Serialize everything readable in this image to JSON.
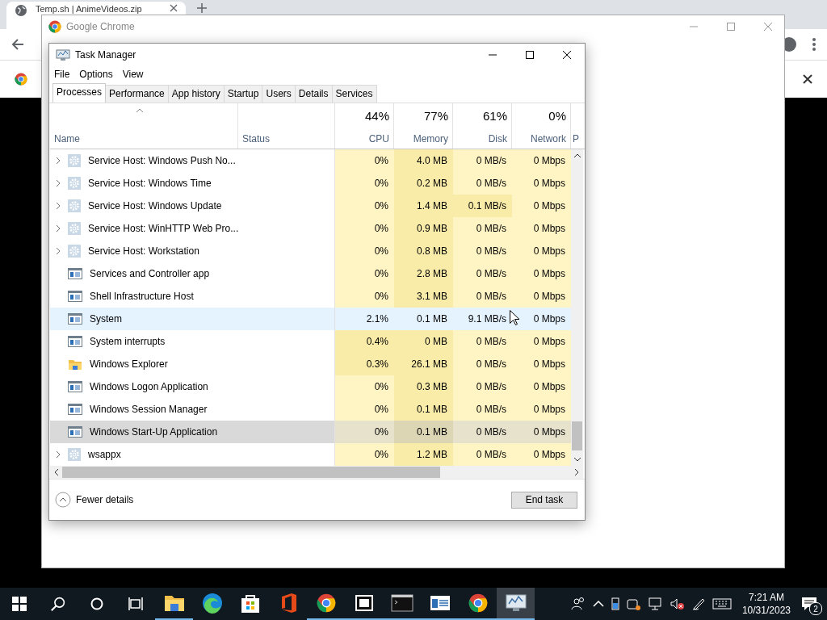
{
  "browser": {
    "tab": {
      "title": "Temp.sh | AnimeVideos.zip"
    }
  },
  "popup": {
    "title": "Google Chrome"
  },
  "window": {
    "title": "Task Manager"
  },
  "menu": [
    "File",
    "Options",
    "View"
  ],
  "tabs": [
    {
      "label": "Processes",
      "selected": true
    },
    {
      "label": "Performance",
      "selected": false
    },
    {
      "label": "App history",
      "selected": false
    },
    {
      "label": "Startup",
      "selected": false
    },
    {
      "label": "Users",
      "selected": false
    },
    {
      "label": "Details",
      "selected": false
    },
    {
      "label": "Services",
      "selected": false
    }
  ],
  "table": {
    "columns": [
      {
        "label": "Name",
        "kind": "text"
      },
      {
        "label": "Status",
        "kind": "text"
      },
      {
        "label": "CPU",
        "percent": "44%",
        "kind": "metric"
      },
      {
        "label": "Memory",
        "percent": "77%",
        "kind": "metric"
      },
      {
        "label": "Disk",
        "percent": "61%",
        "kind": "metric"
      },
      {
        "label": "Network",
        "percent": "0%",
        "kind": "metric"
      },
      {
        "label": "P",
        "kind": "cut"
      }
    ],
    "rows": [
      {
        "kind": "service",
        "expandable": true,
        "selected": false,
        "hovered": false,
        "cells": [
          {
            "text": "Service Host: Windows Push No..."
          },
          {
            "text": ""
          },
          {
            "text": "0%",
            "heavy": false
          },
          {
            "text": "4.0 MB",
            "heavy": true
          },
          {
            "text": "0 MB/s",
            "heavy": false
          },
          {
            "text": "0 Mbps",
            "heavy": false
          }
        ]
      },
      {
        "kind": "service",
        "expandable": true,
        "selected": false,
        "hovered": false,
        "cells": [
          {
            "text": "Service Host: Windows Time"
          },
          {
            "text": ""
          },
          {
            "text": "0%",
            "heavy": false
          },
          {
            "text": "0.2 MB",
            "heavy": true
          },
          {
            "text": "0 MB/s",
            "heavy": false
          },
          {
            "text": "0 Mbps",
            "heavy": false
          }
        ]
      },
      {
        "kind": "service",
        "expandable": true,
        "selected": false,
        "hovered": false,
        "cells": [
          {
            "text": "Service Host: Windows Update"
          },
          {
            "text": ""
          },
          {
            "text": "0%",
            "heavy": false
          },
          {
            "text": "1.4 MB",
            "heavy": true
          },
          {
            "text": "0.1 MB/s",
            "heavy": true
          },
          {
            "text": "0 Mbps",
            "heavy": false
          }
        ]
      },
      {
        "kind": "service",
        "expandable": true,
        "selected": false,
        "hovered": false,
        "cells": [
          {
            "text": "Service Host: WinHTTP Web Pro..."
          },
          {
            "text": ""
          },
          {
            "text": "0%",
            "heavy": false
          },
          {
            "text": "0.9 MB",
            "heavy": true
          },
          {
            "text": "0 MB/s",
            "heavy": false
          },
          {
            "text": "0 Mbps",
            "heavy": false
          }
        ]
      },
      {
        "kind": "service",
        "expandable": true,
        "selected": false,
        "hovered": false,
        "cells": [
          {
            "text": "Service Host: Workstation"
          },
          {
            "text": ""
          },
          {
            "text": "0%",
            "heavy": false
          },
          {
            "text": "0.8 MB",
            "heavy": true
          },
          {
            "text": "0 MB/s",
            "heavy": false
          },
          {
            "text": "0 Mbps",
            "heavy": false
          }
        ]
      },
      {
        "kind": "app",
        "expandable": false,
        "selected": false,
        "hovered": false,
        "cells": [
          {
            "text": "Services and Controller app"
          },
          {
            "text": ""
          },
          {
            "text": "0%",
            "heavy": false
          },
          {
            "text": "2.8 MB",
            "heavy": true
          },
          {
            "text": "0 MB/s",
            "heavy": false
          },
          {
            "text": "0 Mbps",
            "heavy": false
          }
        ]
      },
      {
        "kind": "app",
        "expandable": false,
        "selected": false,
        "hovered": false,
        "cells": [
          {
            "text": "Shell Infrastructure Host"
          },
          {
            "text": ""
          },
          {
            "text": "0%",
            "heavy": false
          },
          {
            "text": "3.1 MB",
            "heavy": true
          },
          {
            "text": "0 MB/s",
            "heavy": false
          },
          {
            "text": "0 Mbps",
            "heavy": false
          }
        ]
      },
      {
        "kind": "app",
        "expandable": false,
        "selected": false,
        "hovered": true,
        "cells": [
          {
            "text": "System"
          },
          {
            "text": ""
          },
          {
            "text": "2.1%"
          },
          {
            "text": "0.1 MB"
          },
          {
            "text": "9.1 MB/s"
          },
          {
            "text": "0 Mbps"
          }
        ]
      },
      {
        "kind": "app",
        "expandable": false,
        "selected": false,
        "hovered": false,
        "cells": [
          {
            "text": "System interrupts"
          },
          {
            "text": ""
          },
          {
            "text": "0.4%",
            "heavy": true
          },
          {
            "text": "0 MB",
            "heavy": true
          },
          {
            "text": "0 MB/s",
            "heavy": false
          },
          {
            "text": "0 Mbps",
            "heavy": false
          }
        ]
      },
      {
        "kind": "folder",
        "expandable": false,
        "selected": false,
        "hovered": false,
        "cells": [
          {
            "text": "Windows Explorer"
          },
          {
            "text": ""
          },
          {
            "text": "0.3%",
            "heavy": true
          },
          {
            "text": "26.1 MB",
            "heavy": true
          },
          {
            "text": "0 MB/s",
            "heavy": false
          },
          {
            "text": "0 Mbps",
            "heavy": false
          }
        ]
      },
      {
        "kind": "app",
        "expandable": false,
        "selected": false,
        "hovered": false,
        "cells": [
          {
            "text": "Windows Logon Application"
          },
          {
            "text": ""
          },
          {
            "text": "0%",
            "heavy": false
          },
          {
            "text": "0.3 MB",
            "heavy": true
          },
          {
            "text": "0 MB/s",
            "heavy": false
          },
          {
            "text": "0 Mbps",
            "heavy": false
          }
        ]
      },
      {
        "kind": "app",
        "expandable": false,
        "selected": false,
        "hovered": false,
        "cells": [
          {
            "text": "Windows Session Manager"
          },
          {
            "text": ""
          },
          {
            "text": "0%",
            "heavy": false
          },
          {
            "text": "0.1 MB",
            "heavy": true
          },
          {
            "text": "0 MB/s",
            "heavy": false
          },
          {
            "text": "0 Mbps",
            "heavy": false
          }
        ]
      },
      {
        "kind": "app",
        "expandable": false,
        "selected": true,
        "hovered": false,
        "cells": [
          {
            "text": "Windows Start-Up Application"
          },
          {
            "text": ""
          },
          {
            "text": "0%",
            "heavy": false
          },
          {
            "text": "0.1 MB",
            "heavy": true
          },
          {
            "text": "0 MB/s",
            "heavy": false
          },
          {
            "text": "0 Mbps",
            "heavy": false
          }
        ]
      },
      {
        "kind": "service",
        "expandable": true,
        "selected": false,
        "hovered": false,
        "cells": [
          {
            "text": "wsappx"
          },
          {
            "text": ""
          },
          {
            "text": "0%",
            "heavy": false
          },
          {
            "text": "1.2 MB",
            "heavy": true
          },
          {
            "text": "0 MB/s",
            "heavy": false
          },
          {
            "text": "0 Mbps",
            "heavy": false
          }
        ]
      }
    ]
  },
  "footer": {
    "toggle": "Fewer details",
    "button": "End task"
  },
  "taskbar": {
    "apps": [
      {
        "kind": "explorer",
        "running": true,
        "active": false
      },
      {
        "kind": "edge",
        "running": false,
        "active": false
      },
      {
        "kind": "store",
        "running": false,
        "active": false
      },
      {
        "kind": "office",
        "running": false,
        "active": false
      },
      {
        "kind": "chrome",
        "running": true,
        "active": false
      },
      {
        "kind": "archive",
        "running": true,
        "active": false
      },
      {
        "kind": "terminal",
        "running": true,
        "active": false
      },
      {
        "kind": "app",
        "running": true,
        "active": false
      },
      {
        "kind": "chrome",
        "running": true,
        "active": false
      },
      {
        "kind": "taskmgr",
        "running": true,
        "active": true
      }
    ],
    "time": "7:21 AM",
    "date": "10/31/2023",
    "notifications": "2"
  }
}
